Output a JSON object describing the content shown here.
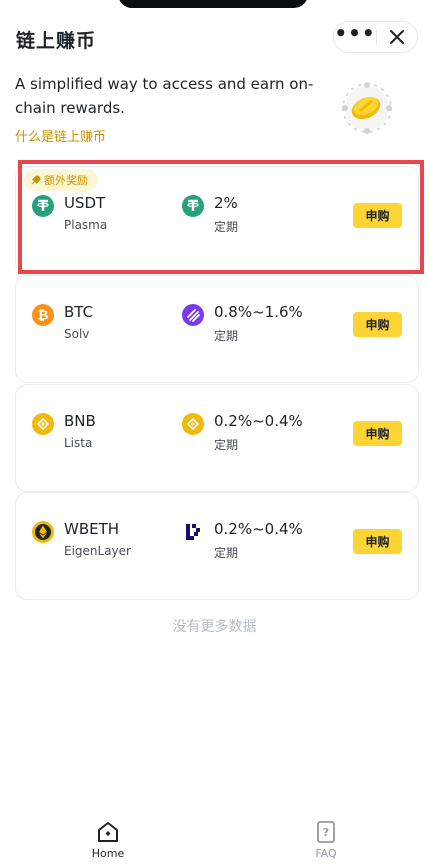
{
  "header": {
    "title": "链上赚币"
  },
  "intro": {
    "description": "A simplified way to access and earn on-chain rewards.",
    "link": "什么是链上赚币"
  },
  "products": [
    {
      "badge": "额外奖励",
      "symbol": "USDT",
      "provider": "Plasma",
      "rate": "2%",
      "term": "定期",
      "button": "申购",
      "coin_color": "#26a17b",
      "rate_icon": "usdt-icon"
    },
    {
      "symbol": "BTC",
      "provider": "Solv",
      "rate": "0.8%~1.6%",
      "term": "定期",
      "button": "申购",
      "coin_color": "#f7931a",
      "rate_icon": "solv-icon"
    },
    {
      "symbol": "BNB",
      "provider": "Lista",
      "rate": "0.2%~0.4%",
      "term": "定期",
      "button": "申购",
      "coin_color": "#f0b90b",
      "rate_icon": "bnb-icon"
    },
    {
      "symbol": "WBETH",
      "provider": "EigenLayer",
      "rate": "0.2%~0.4%",
      "term": "定期",
      "button": "申购",
      "coin_color": "#f0b90b",
      "rate_icon": "eigenlayer-icon"
    }
  ],
  "footer_note": "没有更多数据",
  "tabbar": {
    "home": "Home",
    "faq": "FAQ"
  },
  "colors": {
    "accent": "#fcd535",
    "link": "#c99400",
    "highlight": "#e8474b"
  }
}
